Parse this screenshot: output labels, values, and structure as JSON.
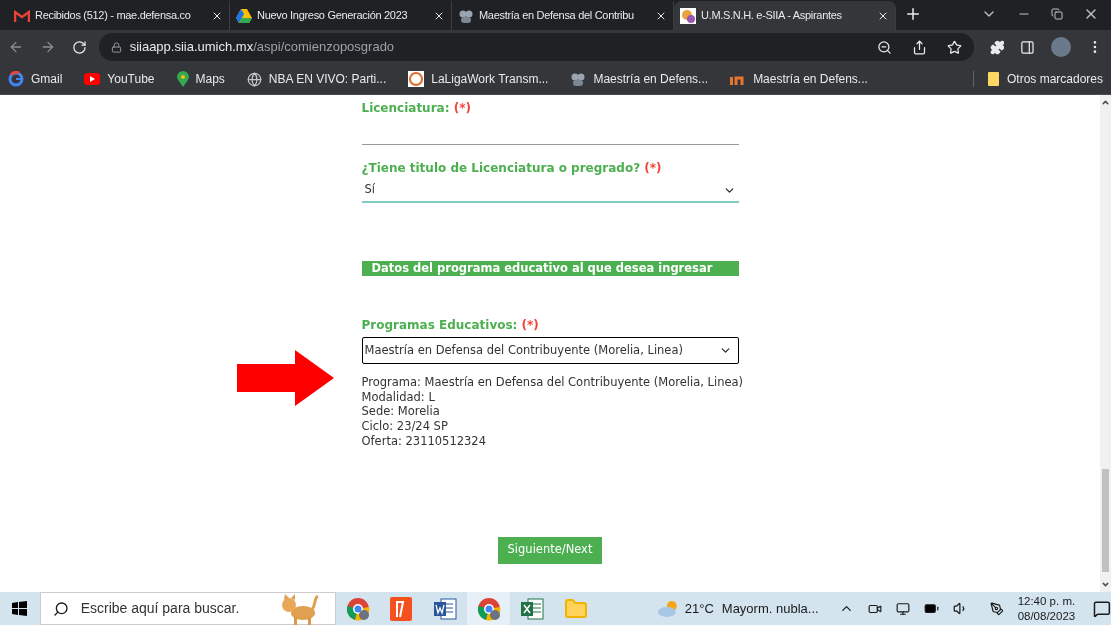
{
  "tabs": [
    {
      "title": "Recibidos (512) - mae.defensa.co",
      "selected": false
    },
    {
      "title": "Nuevo Ingreso Generación 2023",
      "selected": false
    },
    {
      "title": "Maestría en Defensa del Contribu",
      "selected": false
    },
    {
      "title": "U.M.S.N.H. e-SIIA - Aspirantes",
      "selected": true
    }
  ],
  "address": {
    "host": "siiaapp.siia.umich.mx",
    "path": "/aspi/comienzoposgrado"
  },
  "bookmarks": [
    "Gmail",
    "YouTube",
    "Maps",
    "NBA EN VIVO: Parti...",
    "LaLigaWork Transm...",
    "Maestría en Defens...",
    "Maestría en Defens..."
  ],
  "other_bookmarks": "Otros marcadores",
  "form": {
    "licenciatura": {
      "label": "Licenciatura:",
      "required": "(*)"
    },
    "titulo": {
      "label": "¿Tiene titulo de Licenciatura o pregrado?",
      "required": "(*)",
      "value": "Sí"
    },
    "section_header": "Datos del programa educativo al que desea ingresar",
    "programas": {
      "label": "Programas Educativos:",
      "required": "(*)",
      "value": "Maestría en Defensa del Contribuyente (Morelia, Linea)"
    },
    "info": [
      {
        "key": "Programa:",
        "value": "Maestría en Defensa del Contribuyente (Morelia, Linea)"
      },
      {
        "key": "Modalidad:",
        "value": "L"
      },
      {
        "key": "Sede:",
        "value": "Morelia"
      },
      {
        "key": "Ciclo:",
        "value": "23/24 SP"
      },
      {
        "key": "Oferta:",
        "value": "23110512324"
      }
    ],
    "next_button": "Siguiente/Next"
  },
  "taskbar": {
    "search": {
      "placeholder": "Escribe aquí para buscar."
    },
    "apps": [
      {
        "selected": false
      },
      {
        "selected": false
      },
      {
        "selected": false
      },
      {
        "selected": true
      },
      {
        "selected": false
      },
      {
        "selected": false
      }
    ],
    "weather": {
      "temp": "21°C",
      "summary": "Mayorm. nubla..."
    },
    "time": "12:40 p. m.",
    "date": "08/08/2023"
  }
}
